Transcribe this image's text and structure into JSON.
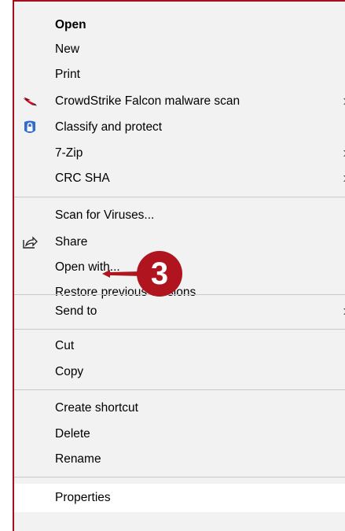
{
  "menu": {
    "items": [
      {
        "label": "Open",
        "bold": true
      },
      {
        "label": "New"
      },
      {
        "label": "Print"
      },
      {
        "label": "CrowdStrike Falcon malware scan",
        "icon": "crowdstrike-falcon-icon",
        "submenu": true
      },
      {
        "label": "Classify and protect",
        "icon": "shield-lock-icon"
      },
      {
        "label": "7-Zip",
        "submenu": true
      },
      {
        "label": "CRC SHA",
        "submenu": true
      },
      {
        "label": "Scan for Viruses..."
      },
      {
        "label": "Share",
        "icon": "share-icon"
      },
      {
        "label": "Open with..."
      },
      {
        "label": "Restore previous versions"
      },
      {
        "label": "Send to",
        "submenu": true
      },
      {
        "label": "Cut"
      },
      {
        "label": "Copy"
      },
      {
        "label": "Create shortcut"
      },
      {
        "label": "Delete"
      },
      {
        "label": "Rename"
      },
      {
        "label": "Properties",
        "hovered": true
      }
    ],
    "submenu_arrow": "›"
  },
  "annotation": {
    "step_number": "3",
    "color": "#b0141e"
  }
}
